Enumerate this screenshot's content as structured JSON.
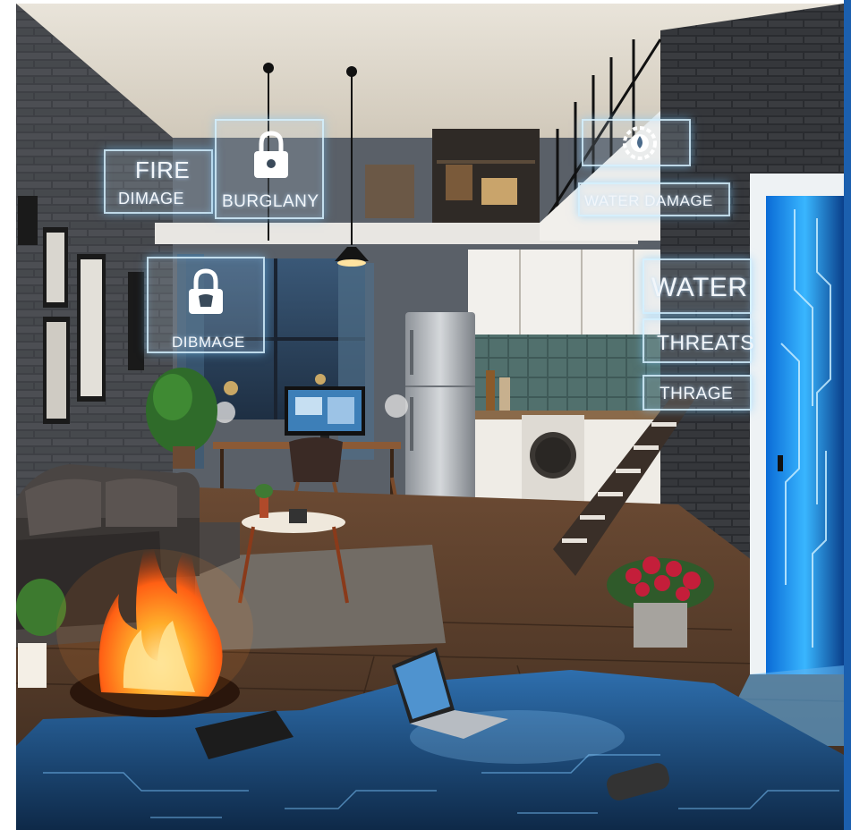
{
  "labels": {
    "fire_title": "FIRE",
    "fire_sub": "DIMAGE",
    "burglary": "BURGLANY",
    "water_damage": "WATER DAMAGE",
    "dibmage": "DIBMAGE",
    "water": "WATER",
    "threats": "THREATS",
    "thrage": "THRAGE"
  },
  "icons": [
    "padlock-icon",
    "padlock-icon",
    "water-drop-gear-icon"
  ],
  "colors": {
    "accent_frame": "#1b5fae",
    "hologram": "#d2f0ff",
    "fire": "#ff7a1a",
    "flood": "#1f5c9a",
    "portal": "#1aa3ff"
  }
}
